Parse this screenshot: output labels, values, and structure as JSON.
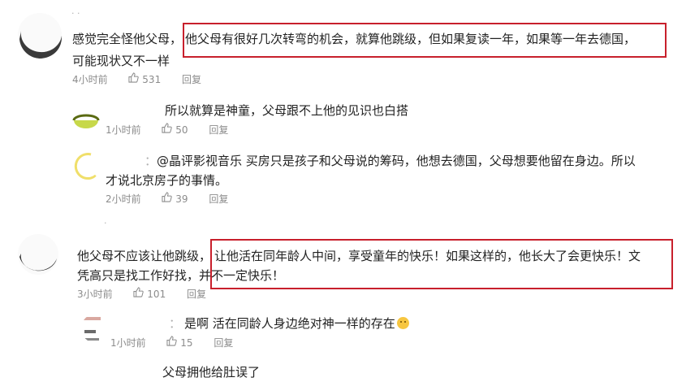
{
  "comments": [
    {
      "text_plain": "感觉完全怪他父母，",
      "text_highlight": "他父母有很好几次转弯的机会，就算他跳级，但如果复读一年，如果等一年去德国，",
      "text_line2": "可能现状又不一样",
      "time": "4小时前",
      "likes": "531",
      "reply_label": "回复",
      "replies": [
        {
          "text": "所以就算是神童，父母跟不上他的见识也白搭",
          "time": "1小时前",
          "likes": "50",
          "reply_label": "回复"
        },
        {
          "name_fragment": "：",
          "text_line1": "@晶评影视音乐 买房只是孩子和父母说的筹码，他想去德国，父母想要他留在身边。所以",
          "text_line2": "才说北京房子的事情。",
          "time": "2小时前",
          "likes": "39",
          "reply_label": "回复"
        }
      ]
    },
    {
      "text_plain": "他父母不应该让他跳级，",
      "text_highlight": "让他活在同年龄人中间，享受童年的快乐！如果这样的，他长大了会更快乐！文",
      "text_line2": "凭高只是找工作好找，并不一定快乐！",
      "time": "3小时前",
      "likes": "101",
      "reply_label": "回复",
      "replies": [
        {
          "name_fragment": "：",
          "text": "是啊 活在同龄人身边绝对神一样的存在",
          "time": "1小时前",
          "likes": "15",
          "reply_label": "回复"
        },
        {
          "text": "父母拥他给肚误了"
        }
      ]
    }
  ],
  "colors": {
    "highlight_border": "#c8202c",
    "meta_text": "#8c8c8c",
    "body_text": "#222222"
  }
}
